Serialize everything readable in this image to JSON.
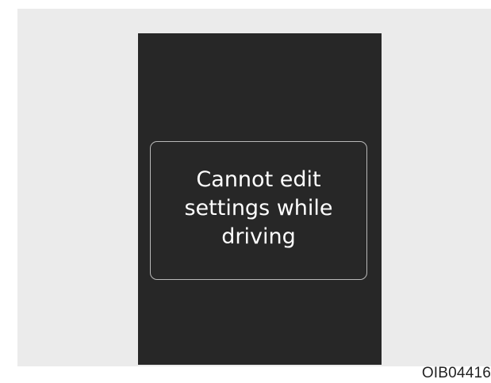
{
  "display": {
    "message": "Cannot edit\nsettings while\ndriving"
  },
  "caption": {
    "image_code": "OIB04416"
  },
  "colors": {
    "panel_background": "#ebebeb",
    "screen_background": "#272727",
    "box_border": "#b9b9b9",
    "message_text": "#ffffff"
  }
}
